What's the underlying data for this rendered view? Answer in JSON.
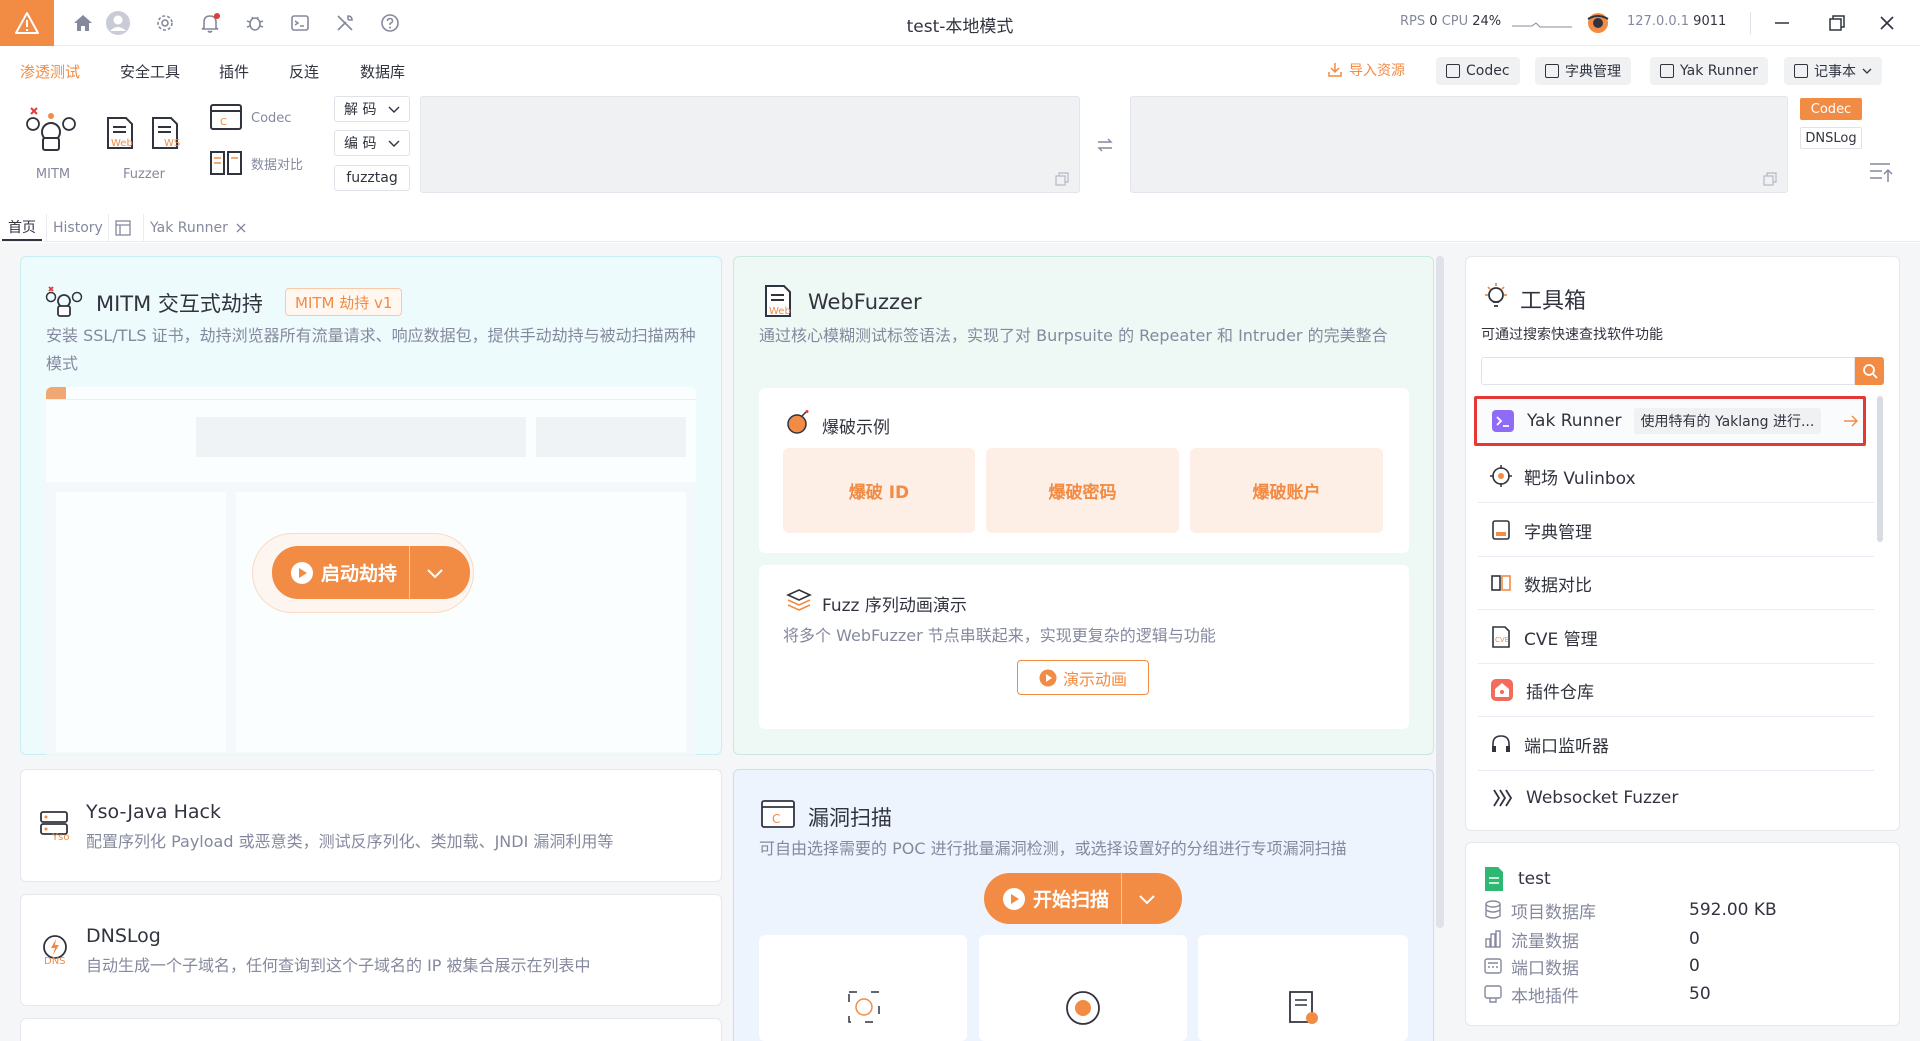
{
  "window": {
    "title": "test-本地模式",
    "perf": {
      "rps_label": "RPS",
      "rps": "0",
      "cpu_label": "CPU",
      "cpu": "24%"
    },
    "address": "127.0.0.1",
    "port": "9011"
  },
  "menu": {
    "items": [
      "渗透测试",
      "安全工具",
      "插件",
      "反连",
      "数据库"
    ],
    "active_index": 0,
    "right_actions": {
      "import": "导入资源",
      "codec": "Codec",
      "dict": "字典管理",
      "yak_runner": "Yak Runner",
      "notepad": "记事本"
    }
  },
  "ribbon": {
    "mitm": "MITM",
    "fuzzer": "Fuzzer",
    "web_icon_text": "Web",
    "ws_icon_text": "WS",
    "codec": "Codec",
    "compare": "数据对比",
    "decode": "解 码",
    "encode": "编 码",
    "fuzztag": "fuzztag",
    "side_codec": "Codec",
    "side_dnslog": "DNSLog"
  },
  "tabs": [
    "首页",
    "History",
    "Yak Runner"
  ],
  "mitm_card": {
    "title": "MITM 交互式劫持",
    "badge": "MITM 劫持 v1",
    "desc": "安装 SSL/TLS 证书，劫持浏览器所有流量请求、响应数据包，提供手动劫持与被动扫描两种模式",
    "start_button": "启动劫持"
  },
  "webfuzzer_card": {
    "title": "WebFuzzer",
    "desc": "通过核心模糊测试标签语法，实现了对 Burpsuite 的 Repeater 和 Intruder 的完美整合",
    "icon_text": "Web",
    "blast": {
      "title": "爆破示例",
      "items": [
        "爆破 ID",
        "爆破密码",
        "爆破账户"
      ]
    },
    "sequence": {
      "title": "Fuzz 序列动画演示",
      "desc": "将多个 WebFuzzer 节点串联起来，实现更复杂的逻辑与功能",
      "button": "演示动画"
    }
  },
  "yso_card": {
    "title": "Yso-Java Hack",
    "desc": "配置序列化 Payload 或恶意类，测试反序列化、类加载、JNDI 漏洞利用等",
    "icon_text": "Yso"
  },
  "dnslog_card": {
    "title": "DNSLog",
    "desc": "自动生成一个子域名，任何查询到这个子域名的 IP 被集合展示在列表中",
    "icon_text": "DNS"
  },
  "vuln_card": {
    "title": "漏洞扫描",
    "desc": "可自由选择需要的 POC 进行批量漏洞检测，或选择设置好的分组进行专项漏洞扫描",
    "button": "开始扫描"
  },
  "toolbox": {
    "title": "工具箱",
    "subtitle": "可通过搜索快速查找软件功能",
    "search_value": "",
    "items": [
      {
        "name": "Yak Runner",
        "desc": "使用特有的 Yaklang 进行...",
        "icon": "terminal-icon",
        "highlighted": true
      },
      {
        "name": "靶场 Vulinbox",
        "icon": "target-icon"
      },
      {
        "name": "字典管理",
        "icon": "dictionary-icon"
      },
      {
        "name": "数据对比",
        "icon": "compare-icon"
      },
      {
        "name": "CVE 管理",
        "icon": "cve-icon"
      },
      {
        "name": "插件仓库",
        "icon": "plugin-store-icon"
      },
      {
        "name": "端口监听器",
        "icon": "headset-icon"
      },
      {
        "name": "Websocket Fuzzer",
        "icon": "websocket-icon"
      }
    ]
  },
  "project": {
    "name": "test",
    "stats": [
      {
        "label": "项目数据库",
        "value": "592.00 KB",
        "icon": "database-icon"
      },
      {
        "label": "流量数据",
        "value": "0",
        "icon": "chart-icon"
      },
      {
        "label": "端口数据",
        "value": "0",
        "icon": "port-icon"
      },
      {
        "label": "本地插件",
        "value": "50",
        "icon": "plugin-icon"
      }
    ]
  },
  "colors": {
    "accent": "#f28b44",
    "highlight_border": "#e53935",
    "text": "#31343f",
    "muted": "#85899e"
  }
}
